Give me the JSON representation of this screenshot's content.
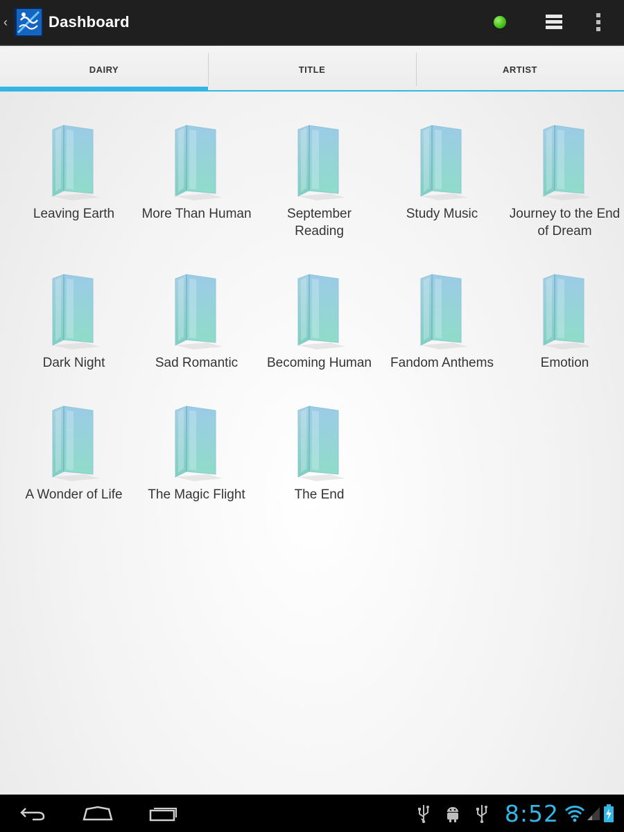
{
  "app": {
    "title": "Dashboard",
    "icons": {
      "up": "chevron-left-icon",
      "app": "app-logo-icon",
      "status": "status-dot-icon",
      "view": "list-view-icon",
      "menu": "overflow-menu-icon"
    },
    "colors": {
      "actionbar": "#1f1f1f",
      "accent": "#33b5e5",
      "status_dot": "#48c21a"
    }
  },
  "tabs": [
    {
      "label": "DAIRY",
      "selected": true
    },
    {
      "label": "TITLE",
      "selected": false
    },
    {
      "label": "ARTIST",
      "selected": false
    }
  ],
  "folders": [
    {
      "label": "Leaving Earth"
    },
    {
      "label": "More Than Human"
    },
    {
      "label": "September Reading"
    },
    {
      "label": "Study Music"
    },
    {
      "label": "Journey to the End of Dream"
    },
    {
      "label": "Dark Night"
    },
    {
      "label": "Sad Romantic"
    },
    {
      "label": "Becoming Human"
    },
    {
      "label": "Fandom Anthems"
    },
    {
      "label": "Emotion"
    },
    {
      "label": "A Wonder of Life"
    },
    {
      "label": "The Magic Flight"
    },
    {
      "label": "The End"
    }
  ],
  "system_bar": {
    "time": "8:52",
    "icons": [
      "back-icon",
      "home-icon",
      "recent-apps-icon",
      "usb-icon",
      "android-debug-icon",
      "usb-icon",
      "wifi-icon",
      "signal-icon",
      "battery-charging-icon"
    ]
  }
}
